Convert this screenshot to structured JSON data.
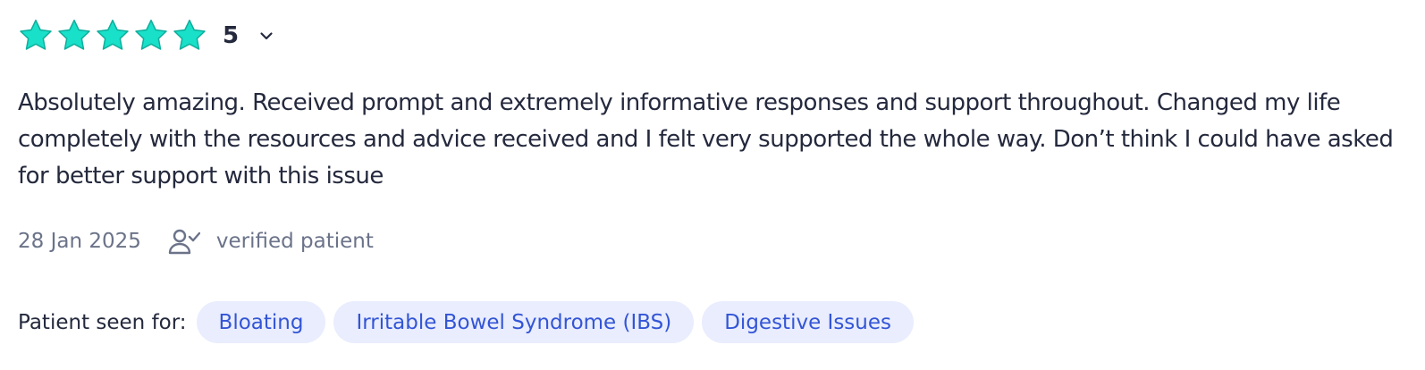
{
  "rating": {
    "stars": 5,
    "value": "5",
    "star_color": "#19e0c8",
    "star_outline": "#0fae9c"
  },
  "review": {
    "text": "Absolutely amazing. Received prompt and extremely informative responses and support throughout. Changed my life completely with the resources and advice received and I felt very supported the whole way. Don’t think I could have asked for better support with this issue"
  },
  "meta": {
    "date": "28 Jan 2025",
    "verified_icon": "user-check-icon",
    "verified_label": "verified patient"
  },
  "seen_for": {
    "label": "Patient seen for:",
    "tags": [
      "Bloating",
      "Irritable Bowel Syndrome (IBS)",
      "Digestive Issues"
    ]
  },
  "colors": {
    "text": "#24293d",
    "muted": "#6b7389",
    "tag_bg": "#e9edfd",
    "tag_text": "#3355d6"
  }
}
